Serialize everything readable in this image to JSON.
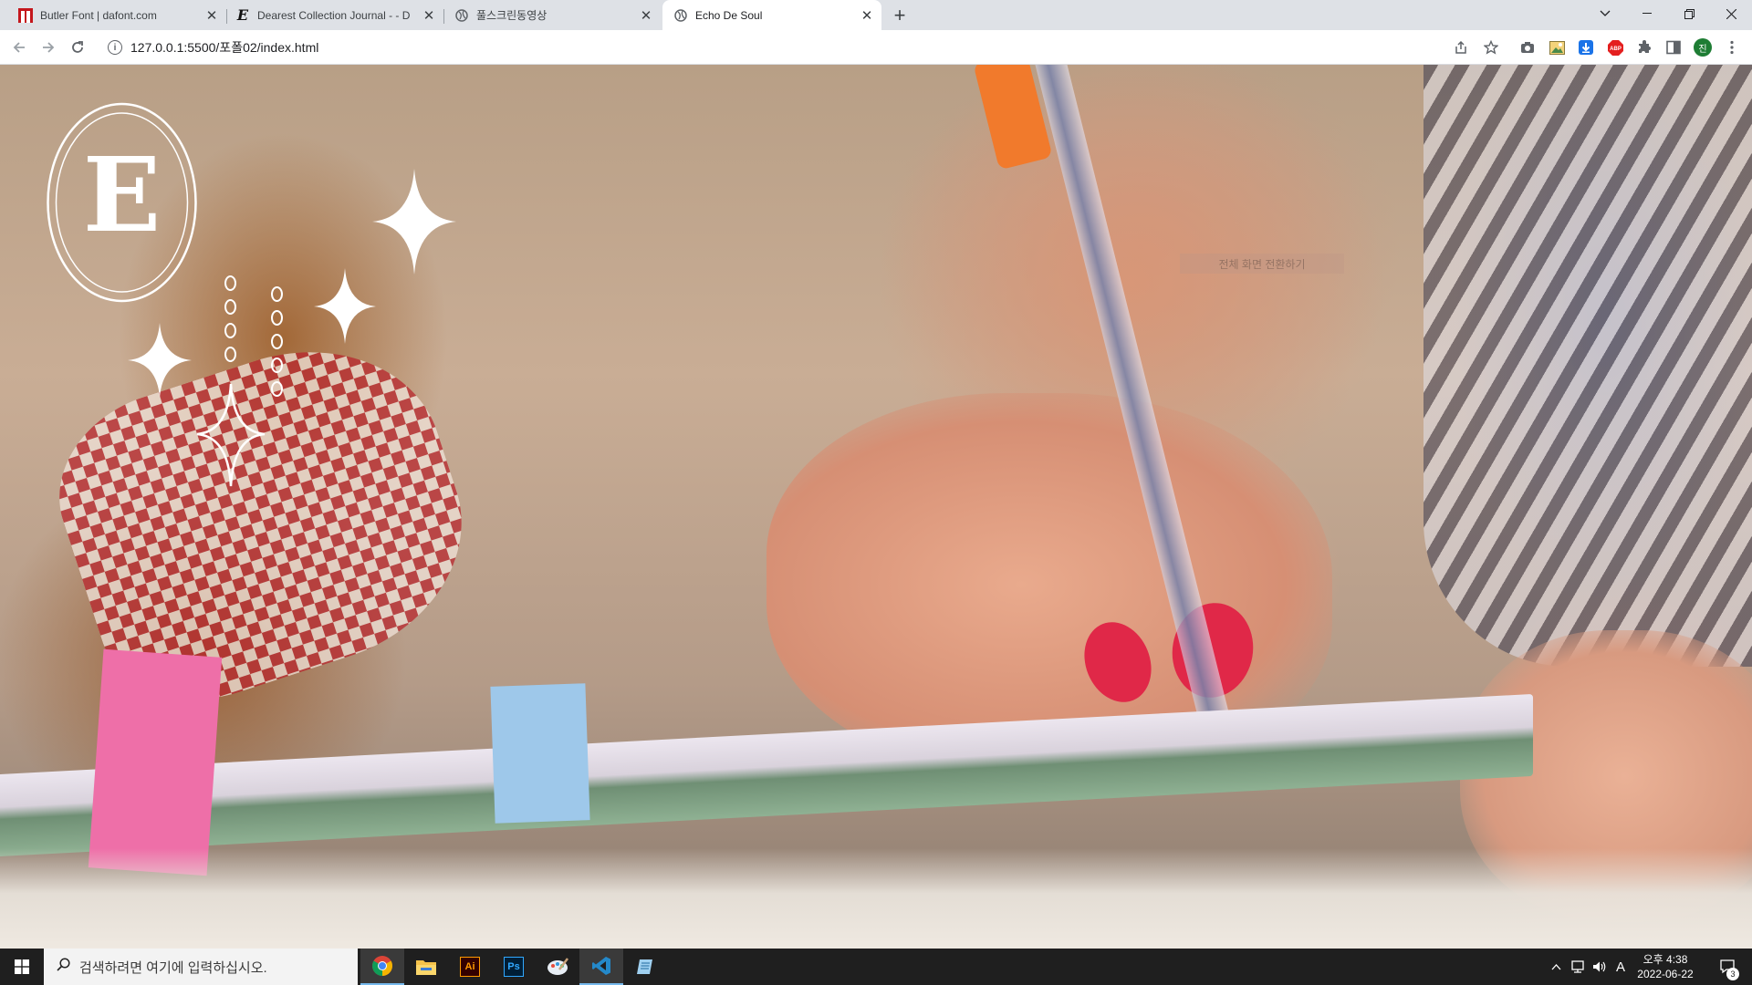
{
  "browser": {
    "tabs": [
      {
        "title": "Butler Font | dafont.com",
        "favicon": "dafont-icon",
        "active": false
      },
      {
        "title": "Dearest Collection Journal - - D",
        "favicon": "e-letter-icon",
        "active": false
      },
      {
        "title": "풀스크린동영상",
        "favicon": "globe-icon",
        "active": false
      },
      {
        "title": "Echo De Soul",
        "favicon": "globe-icon",
        "active": true
      }
    ],
    "new_tab_label": "+",
    "url": "127.0.0.1:5500/포폴02/index.html",
    "window_controls": [
      "chevron-down-icon",
      "minimize-icon",
      "restore-icon",
      "close-icon"
    ],
    "toolbar_icons": [
      "share-icon",
      "star-icon",
      "camera-icon",
      "image-icon",
      "download-icon",
      "adblock-icon",
      "extensions-icon",
      "sidepanel-icon",
      "profile-avatar",
      "menu-icon"
    ],
    "adblock_label": "ABP",
    "profile_initial": "진"
  },
  "page": {
    "logo_letter": "E",
    "overlay_text": "전체 화면 전환하기",
    "dots_left_count": 4,
    "dots_right_count": 5
  },
  "taskbar": {
    "search_placeholder": "검색하려면 여기에 입력하십시오.",
    "apps": [
      "chrome-icon",
      "file-explorer-icon",
      "illustrator-icon",
      "photoshop-icon",
      "paint-icon",
      "vscode-icon",
      "notepad-icon"
    ],
    "illustrator_label": "Ai",
    "photoshop_label": "Ps",
    "ime_label": "A",
    "time": "오후 4:38",
    "date": "2022-06-22",
    "notification_count": "3"
  }
}
